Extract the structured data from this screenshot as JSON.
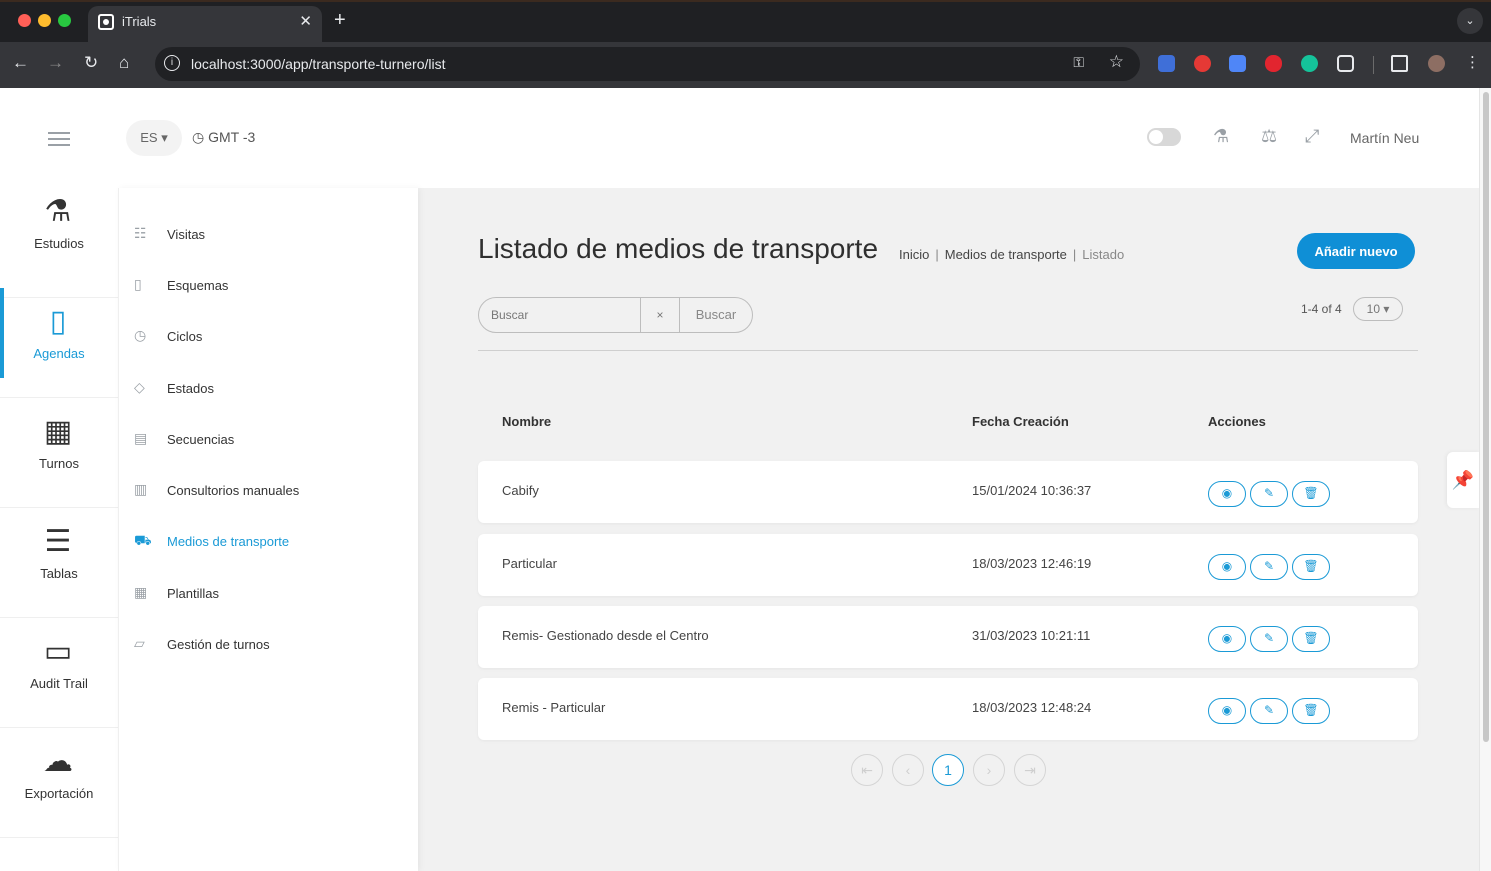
{
  "browser": {
    "tab_title": "iTrials",
    "url": "localhost:3000/app/transporte-turnero/list"
  },
  "header": {
    "language": "ES ▾",
    "timezone": "GMT -3",
    "user_name": "Martín Neu"
  },
  "rail": {
    "items": [
      {
        "label": "Estudios",
        "icon": "microscope-icon"
      },
      {
        "label": "Agendas",
        "icon": "book-icon"
      },
      {
        "label": "Turnos",
        "icon": "calendar-icon"
      },
      {
        "label": "Tablas",
        "icon": "list-icon"
      },
      {
        "label": "Audit Trail",
        "icon": "id-card-icon"
      },
      {
        "label": "Exportación",
        "icon": "cloud-download-icon"
      }
    ]
  },
  "subnav": {
    "items": [
      {
        "label": "Visitas"
      },
      {
        "label": "Esquemas"
      },
      {
        "label": "Ciclos"
      },
      {
        "label": "Estados"
      },
      {
        "label": "Secuencias"
      },
      {
        "label": "Consultorios manuales"
      },
      {
        "label": "Medios de transporte"
      },
      {
        "label": "Plantillas"
      },
      {
        "label": "Gestión de turnos"
      }
    ]
  },
  "page": {
    "title": "Listado de medios de transporte",
    "breadcrumb": [
      "Inicio",
      "Medios de transporte",
      "Listado"
    ],
    "add_button": "Añadir nuevo",
    "search_placeholder": "Buscar",
    "clear_label": "×",
    "search_button": "Buscar",
    "range_text": "1-4 of 4",
    "page_size": "10 ▾"
  },
  "table": {
    "columns": [
      "Nombre",
      "Fecha Creación",
      "Acciones"
    ],
    "rows": [
      {
        "name": "Cabify",
        "date": "15/01/2024 10:36:37"
      },
      {
        "name": "Particular",
        "date": "18/03/2023 12:46:19"
      },
      {
        "name": "Remis- Gestionado desde el Centro",
        "date": "31/03/2023 10:21:11"
      },
      {
        "name": "Remis - Particular",
        "date": "18/03/2023 12:48:24"
      }
    ]
  },
  "pagination": {
    "current_page": "1"
  },
  "colors": {
    "accent": "#1a9ad6",
    "primary_button": "#0f8fd6"
  }
}
